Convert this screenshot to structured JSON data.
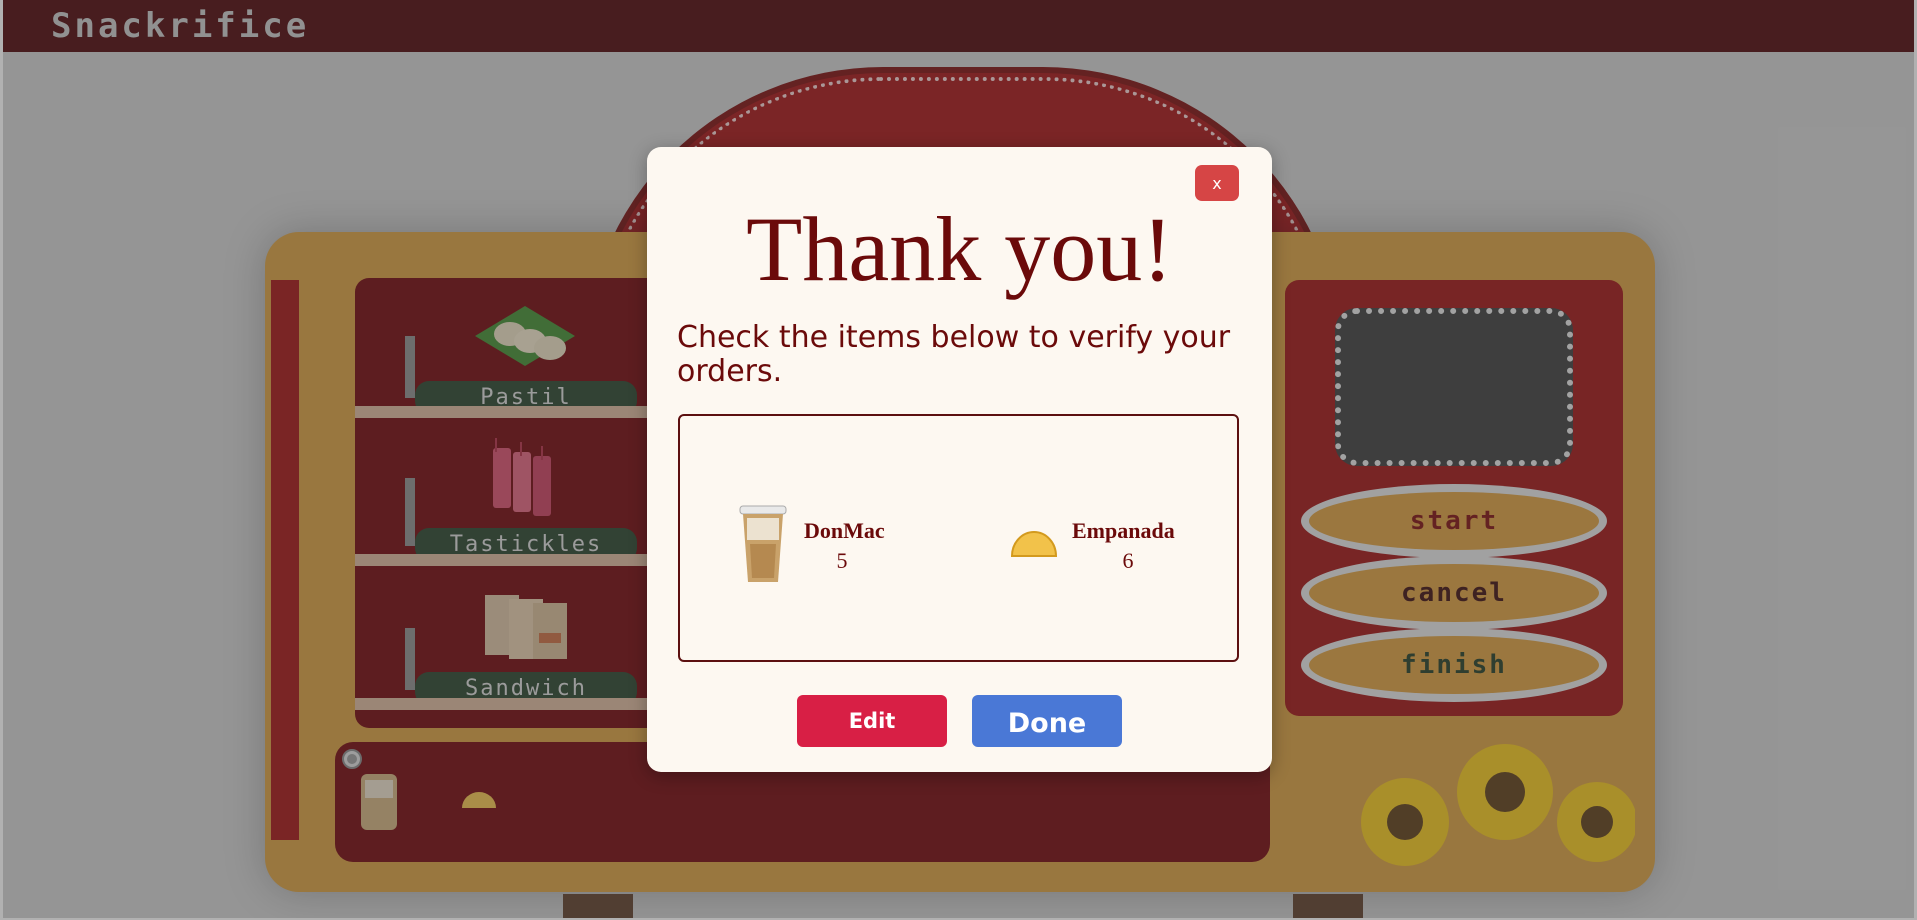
{
  "app": {
    "title": "Snackrifice"
  },
  "shelves": [
    {
      "label": "Pastil"
    },
    {
      "label": "Tastickles"
    },
    {
      "label": "Sandwich"
    }
  ],
  "controls": {
    "start": "start",
    "cancel": "cancel",
    "finish": "finish"
  },
  "modal": {
    "close_label": "x",
    "title": "Thank you!",
    "subtitle": "Check the items below to verify your orders.",
    "items": [
      {
        "name": "DonMac",
        "qty": "5",
        "icon": "iced-coffee-icon"
      },
      {
        "name": "Empanada",
        "qty": "6",
        "icon": "empanada-icon"
      }
    ],
    "edit_label": "Edit",
    "done_label": "Done"
  },
  "colors": {
    "brand_dark": "#4a0005",
    "title_text": "#6b0a0a",
    "edit": "#d81f45",
    "done": "#4a78d6",
    "close": "#d64545"
  }
}
